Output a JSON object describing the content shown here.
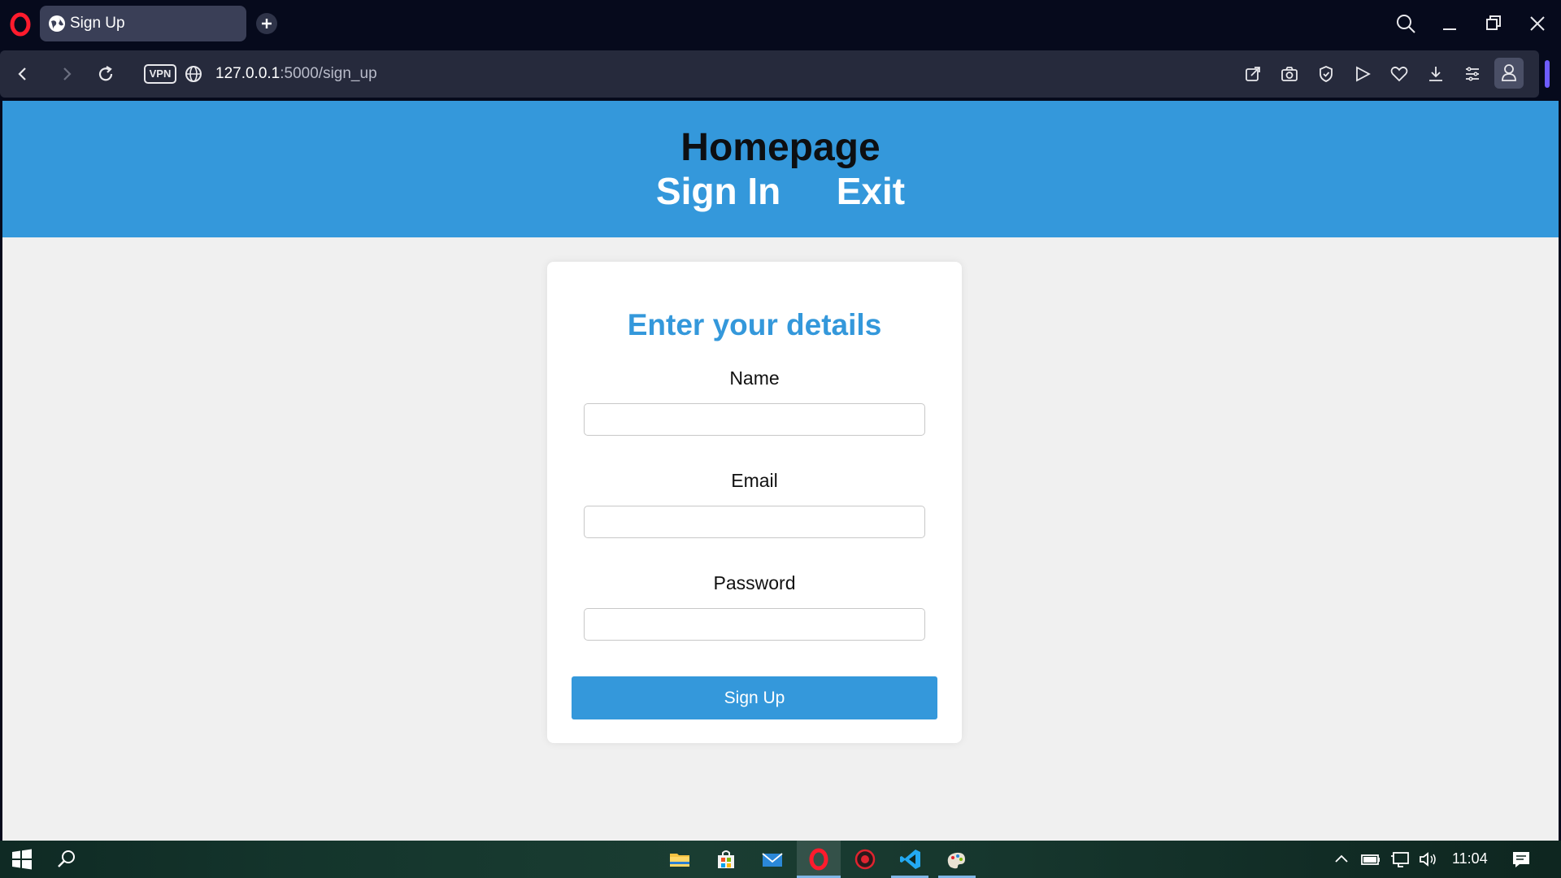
{
  "browser": {
    "tab_title": "Sign Up",
    "url_host": "127.0.0.1",
    "url_path": ":5000/sign_up",
    "vpn_label": "VPN",
    "accent_color": "#6e5cff"
  },
  "page": {
    "header": {
      "title": "Homepage",
      "nav": [
        "Sign In",
        "Exit"
      ],
      "background_color": "#3498db"
    },
    "form": {
      "title": "Enter your details",
      "fields": [
        {
          "label": "Name",
          "value": "",
          "type": "text"
        },
        {
          "label": "Email",
          "value": "",
          "type": "email"
        },
        {
          "label": "Password",
          "value": "",
          "type": "password"
        }
      ],
      "submit_label": "Sign Up"
    }
  },
  "taskbar": {
    "clock": "11:04",
    "pinned_apps": [
      "file-explorer-icon",
      "microsoft-store-icon",
      "mail-icon",
      "opera-icon",
      "recorder-icon",
      "vscode-icon",
      "paint-icon"
    ]
  }
}
